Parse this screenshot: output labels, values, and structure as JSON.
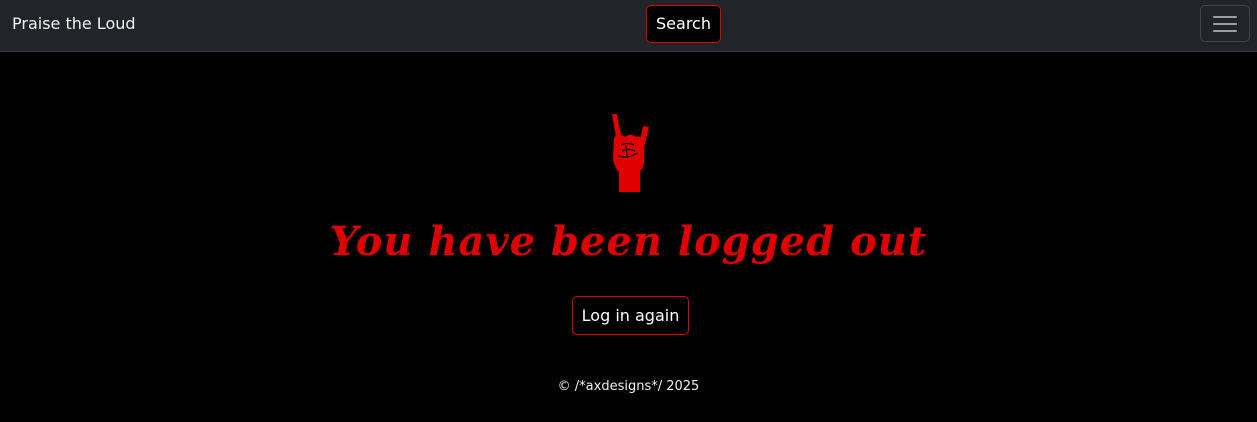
{
  "navbar": {
    "brand": "Praise the Loud",
    "search_label": "Search",
    "menu_icon": "hamburger-menu-icon"
  },
  "main": {
    "icon": "rock-hand-icon",
    "heading": "You have been logged out",
    "login_again_label": "Log in again"
  },
  "footer": {
    "copyright": "© /*axdesigns*/ 2025"
  },
  "colors": {
    "accent": "#e00000",
    "navbar_bg": "#212529",
    "page_bg": "#000000",
    "text": "#ffffff"
  }
}
